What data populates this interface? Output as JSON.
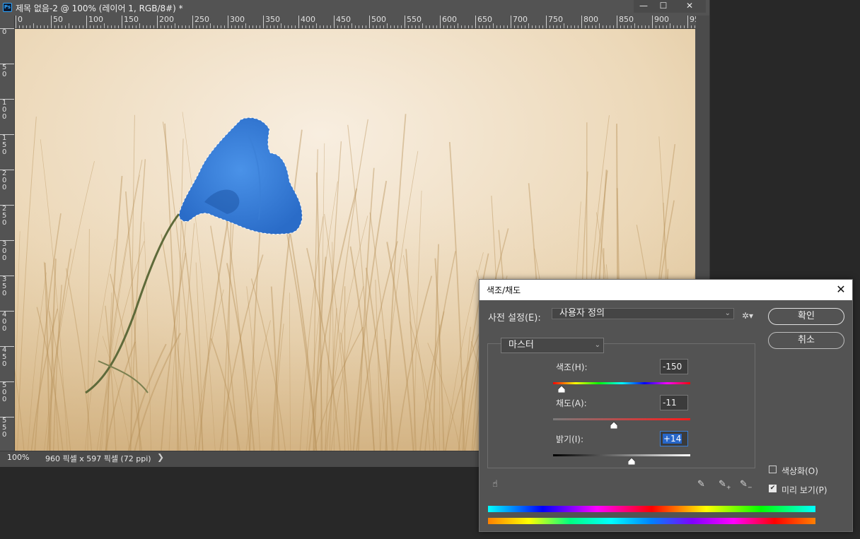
{
  "document": {
    "title": "제목 없음-2 @ 100% (레이어 1, RGB/8#) *",
    "app_icon": "Ps",
    "window_controls": {
      "minimize": "—",
      "maximize": "☐",
      "close": "✕"
    },
    "ruler_top": [
      "0",
      "50",
      "100",
      "150",
      "200",
      "250",
      "300",
      "350",
      "400",
      "450",
      "500",
      "550",
      "600",
      "650",
      "700",
      "750",
      "800",
      "850",
      "900",
      "95"
    ],
    "ruler_left": [
      "0",
      "5\n0",
      "1\n0\n0",
      "1\n5\n0",
      "2\n0\n0",
      "2\n5\n0",
      "3\n0\n0",
      "3\n5\n0",
      "4\n0\n0",
      "4\n5\n0",
      "5\n0\n0",
      "5\n5\n0"
    ],
    "status": {
      "zoom": "100%",
      "info": "960 픽셀 x 597 픽셀 (72 ppi)",
      "arrow": "❯"
    }
  },
  "dialog": {
    "title": "색조/채도",
    "close": "✕",
    "preset_label": "사전 설정(E):",
    "preset_value": "사용자 정의",
    "ok_label": "확인",
    "cancel_label": "취소",
    "channel_value": "마스터",
    "hue": {
      "label": "색조(H):",
      "value": "-150",
      "position": 0.06
    },
    "saturation": {
      "label": "채도(A):",
      "value": "-11",
      "position": 0.445
    },
    "lightness": {
      "label": "밝기(I):",
      "value": "+14",
      "position": 0.57
    },
    "colorize_label": "색상화(O)",
    "colorize_checked": false,
    "preview_label": "미리 보기(P)",
    "preview_checked": true,
    "icons": [
      "hand-target-icon",
      "eyedropper-icon",
      "eyedropper-plus-icon",
      "eyedropper-minus-icon",
      "gear-icon"
    ]
  }
}
